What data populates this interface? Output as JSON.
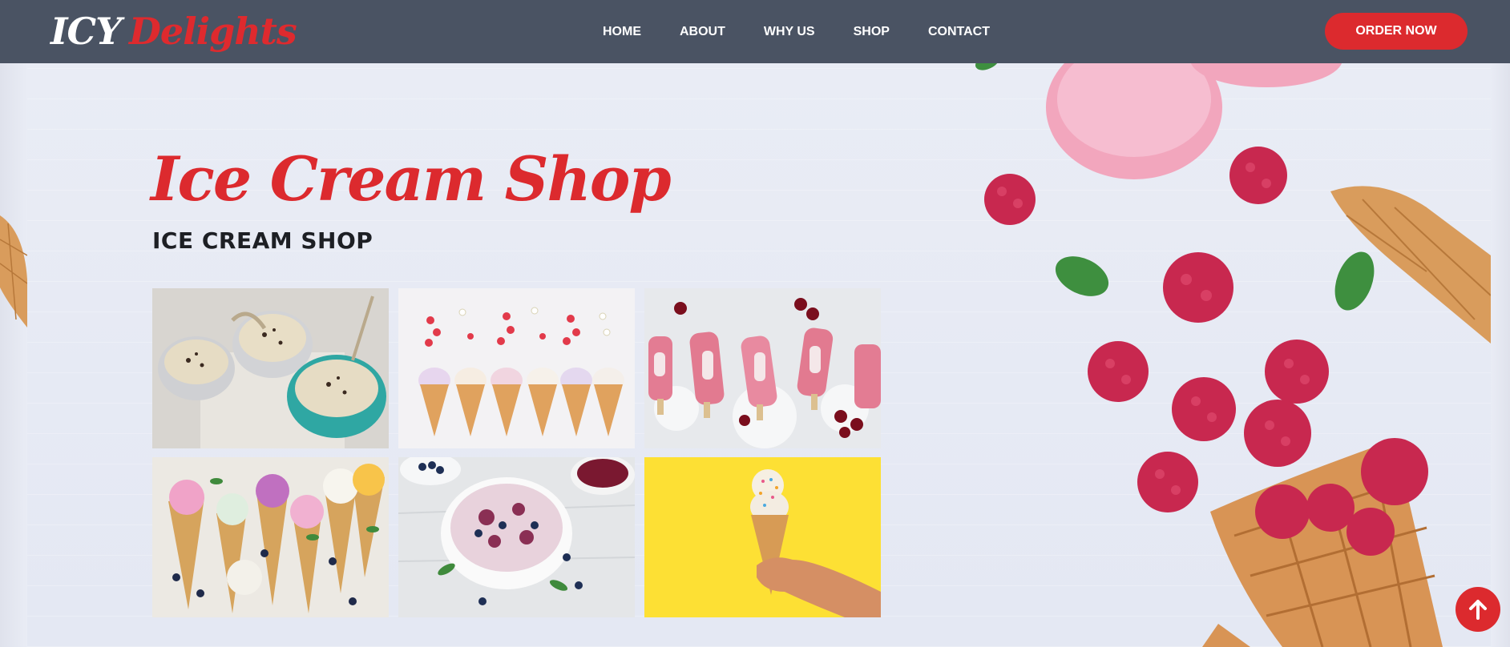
{
  "brand": {
    "logo_part1": "ICY",
    "logo_part2": "Delights"
  },
  "nav": {
    "links": [
      "HOME",
      "ABOUT",
      "WHY US",
      "SHOP",
      "CONTACT"
    ],
    "order_button": "ORDER NOW"
  },
  "hero": {
    "title": "Ice Cream Shop",
    "subtitle": "ICE CREAM SHOP"
  },
  "gallery": {
    "tiles": [
      "ice-cream-bowls-photo",
      "strawberry-cones-photo",
      "cherry-popsicles-photo",
      "flower-cones-photo",
      "blueberry-bowl-photo",
      "cone-on-yellow-photo"
    ]
  },
  "icons": {
    "scroll_top": "arrow-up-icon"
  },
  "colors": {
    "navbar": "#4a5363",
    "accent": "#dc2a2e",
    "background": "#e8ebf4",
    "white": "#ffffff"
  }
}
